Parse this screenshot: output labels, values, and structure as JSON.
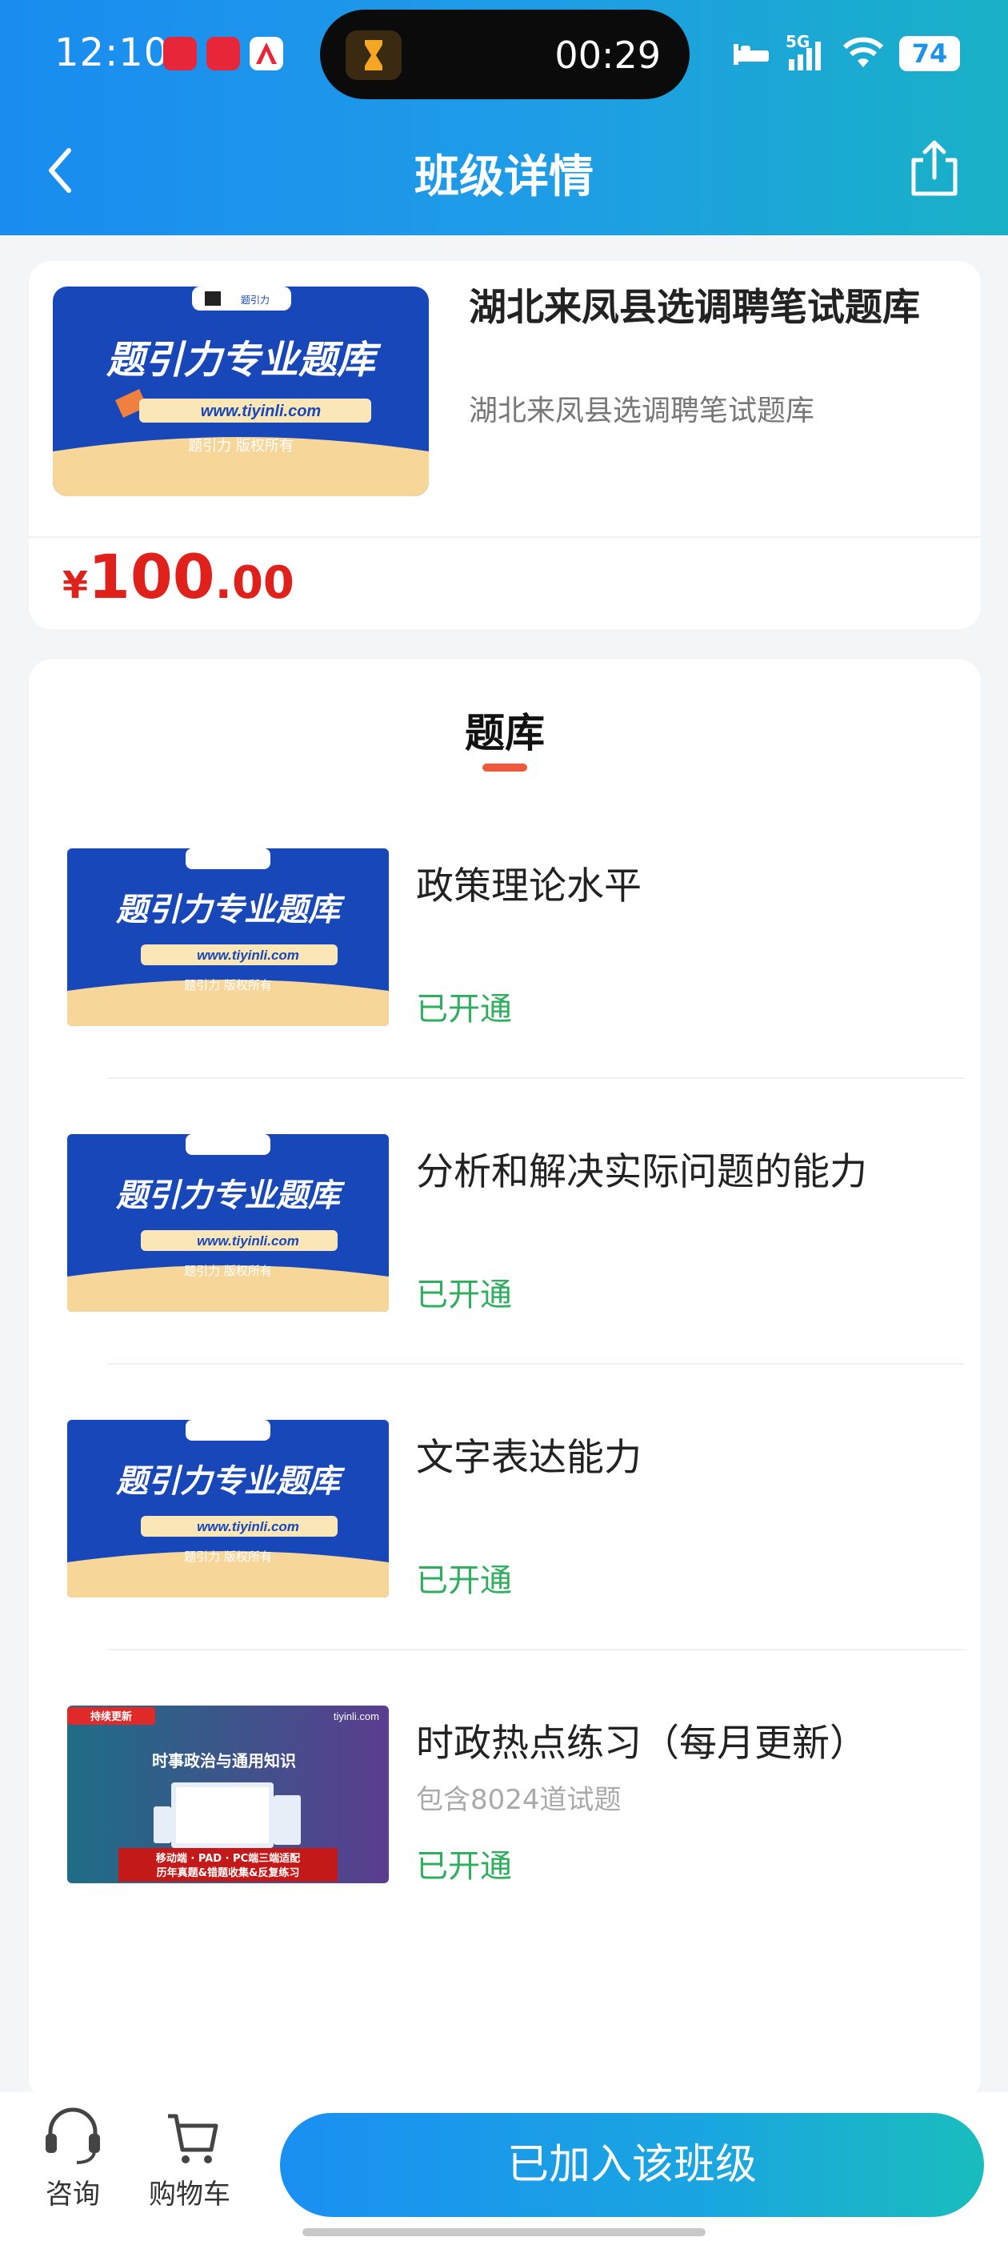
{
  "status_bar": {
    "time": "12:10",
    "timer": "00:29",
    "network": "5G",
    "battery": "74"
  },
  "nav": {
    "title": "班级详情"
  },
  "product": {
    "title": "湖北来凤县选调聘笔试题库",
    "subtitle": "湖北来凤县选调聘笔试题库",
    "price_symbol": "¥",
    "price_int": "100",
    "price_dec": ".00",
    "thumb": {
      "brand_tag": "题引力",
      "headline": "题引力专业题库",
      "url": "www.tiyinli.com",
      "copyright": "题引力 版权所有"
    }
  },
  "tiku": {
    "section_title": "题库",
    "items": [
      {
        "name": "政策理论水平",
        "count": "",
        "status": "已开通"
      },
      {
        "name": "分析和解决实际问题的能力",
        "count": "",
        "status": "已开通"
      },
      {
        "name": "文字表达能力",
        "count": "",
        "status": "已开通"
      },
      {
        "name": "时政热点练习（每月更新）",
        "count": "包含8024道试题",
        "status": "已开通"
      }
    ],
    "promo_thumb": {
      "badge": "持续更新",
      "site": "tiyinli.com",
      "heading": "时事政治与通用知识",
      "footer_line1": "移动端 · PAD · PC端三端适配",
      "footer_line2": "历年真题&错题收集&反复练习"
    }
  },
  "bottom_bar": {
    "consult_label": "咨询",
    "cart_label": "购物车",
    "join_label": "已加入该班级"
  },
  "colors": {
    "header_start": "#1a8cf0",
    "header_end": "#19b1c6",
    "price": "#e0211b",
    "status_green": "#2fae5e",
    "accent_underline": "#ef5a3c"
  }
}
